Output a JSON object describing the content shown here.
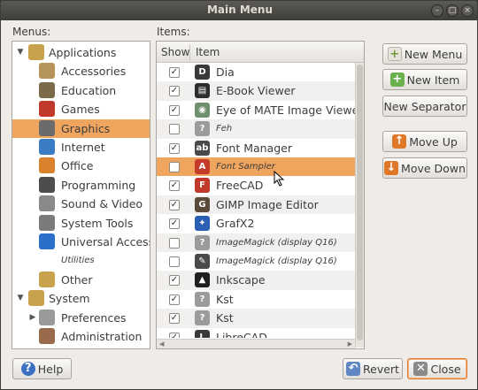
{
  "window": {
    "title": "Main Menu",
    "controls": [
      "–",
      "□",
      "×"
    ]
  },
  "menus_label": "Menus:",
  "items_label": "Items:",
  "tree": [
    {
      "label": "Applications",
      "level": 0,
      "expander": "open",
      "icon": "applications-icon",
      "color": "#c9a24d"
    },
    {
      "label": "Accessories",
      "level": 1,
      "icon": "accessories-icon",
      "color": "#b7955a"
    },
    {
      "label": "Education",
      "level": 1,
      "icon": "education-icon",
      "color": "#7a6a4a"
    },
    {
      "label": "Games",
      "level": 1,
      "icon": "games-icon",
      "color": "#c0392b"
    },
    {
      "label": "Graphics",
      "level": 1,
      "icon": "graphics-icon",
      "color": "#6b6b6b",
      "selected": true
    },
    {
      "label": "Internet",
      "level": 1,
      "icon": "internet-icon",
      "color": "#3b7dc4"
    },
    {
      "label": "Office",
      "level": 1,
      "icon": "office-icon",
      "color": "#d9822b"
    },
    {
      "label": "Programming",
      "level": 1,
      "icon": "programming-icon",
      "color": "#4d4d4d"
    },
    {
      "label": "Sound & Video",
      "level": 1,
      "icon": "sound-video-icon",
      "color": "#8a8a8a"
    },
    {
      "label": "System Tools",
      "level": 1,
      "icon": "system-tools-icon",
      "color": "#7b7b7b"
    },
    {
      "label": "Universal Access",
      "level": 1,
      "icon": "universal-access-icon",
      "color": "#2a6fc9"
    },
    {
      "label": "Utilities",
      "level": 1,
      "icon": "",
      "italic": true
    },
    {
      "label": "Other",
      "level": 1,
      "icon": "other-icon",
      "color": "#c9a24d"
    },
    {
      "label": "System",
      "level": 0,
      "expander": "open",
      "icon": "system-icon",
      "color": "#c9a24d"
    },
    {
      "label": "Preferences",
      "level": 1,
      "expander": "closed",
      "icon": "preferences-icon",
      "color": "#9a9a9a"
    },
    {
      "label": "Administration",
      "level": 1,
      "icon": "administration-icon",
      "color": "#9a6b4a"
    }
  ],
  "list_header": {
    "show": "Show",
    "item": "Item"
  },
  "items": [
    {
      "label": "Dia",
      "checked": true,
      "icon": "dia-icon",
      "glyph": "D",
      "color": "#3a3a3a"
    },
    {
      "label": "E-Book Viewer",
      "checked": true,
      "icon": "ebook-viewer-icon",
      "glyph": "▤",
      "color": "#2d2d2d"
    },
    {
      "label": "Eye of MATE Image Viewer",
      "checked": true,
      "icon": "image-viewer-icon",
      "glyph": "◉",
      "color": "#6f8f6f"
    },
    {
      "label": "Feh",
      "checked": false,
      "italic": true,
      "icon": "unknown-icon",
      "glyph": "?",
      "color": "#9b9b9b"
    },
    {
      "label": "Font Manager",
      "checked": true,
      "icon": "font-manager-icon",
      "glyph": "ab",
      "color": "#4a4a4a"
    },
    {
      "label": "Font Sampler",
      "checked": false,
      "italic": true,
      "selected": true,
      "icon": "font-sampler-icon",
      "glyph": "A",
      "color": "#c43b2b"
    },
    {
      "label": "FreeCAD",
      "checked": true,
      "icon": "freecad-icon",
      "glyph": "F",
      "color": "#c0392b"
    },
    {
      "label": "GIMP Image Editor",
      "checked": true,
      "icon": "gimp-icon",
      "glyph": "G",
      "color": "#5a4a3a"
    },
    {
      "label": "GrafX2",
      "checked": true,
      "icon": "grafx2-icon",
      "glyph": "✦",
      "color": "#2b5fb3"
    },
    {
      "label": "ImageMagick (display Q16)",
      "checked": false,
      "italic": true,
      "icon": "unknown-icon",
      "glyph": "?",
      "color": "#9b9b9b"
    },
    {
      "label": "ImageMagick (display Q16)",
      "checked": false,
      "italic": true,
      "icon": "imagemagick-icon",
      "glyph": "✎",
      "color": "#4a4a4a"
    },
    {
      "label": "Inkscape",
      "checked": true,
      "icon": "inkscape-icon",
      "glyph": "▲",
      "color": "#1f1f1f"
    },
    {
      "label": "Kst",
      "checked": true,
      "icon": "unknown-icon",
      "glyph": "?",
      "color": "#9b9b9b"
    },
    {
      "label": "Kst",
      "checked": true,
      "icon": "unknown-icon",
      "glyph": "?",
      "color": "#9b9b9b"
    },
    {
      "label": "LibreCAD",
      "checked": true,
      "icon": "librecad-icon",
      "glyph": "L",
      "color": "#3a3a3a"
    }
  ],
  "buttons": {
    "new_menu": "New Menu",
    "new_item": "New Item",
    "new_separator": "New Separator",
    "move_up": "Move Up",
    "move_down": "Move Down",
    "help": "Help",
    "revert": "Revert",
    "close": "Close"
  },
  "colors": {
    "selection": "#f0a55e",
    "titlebar": "#3e3d39",
    "window_bg": "#efebe7"
  }
}
